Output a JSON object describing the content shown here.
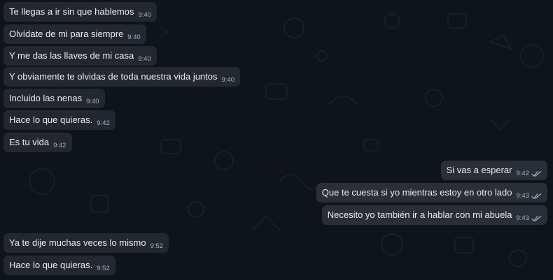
{
  "chat": {
    "incoming_1": [
      {
        "text": "Te llegas a ir sin que hablemos",
        "time": "9:40"
      },
      {
        "text": "Olvídate de mi para siempre",
        "time": "9:40"
      },
      {
        "text": "Y me das las llaves de mi casa",
        "time": "9:40"
      },
      {
        "text": "Y obviamente te olvidas de toda nuestra vida juntos",
        "time": "9:40"
      },
      {
        "text": "Incluido las nenas",
        "time": "9:40"
      },
      {
        "text": "Hace lo que quieras.",
        "time": "9:42"
      },
      {
        "text": "Es tu vida",
        "time": "9:42"
      }
    ],
    "outgoing": [
      {
        "text": "Si vas a esperar",
        "time": "9:42",
        "status": "read"
      },
      {
        "text": "Que te cuesta si yo mientras estoy en otro lado",
        "time": "9:43",
        "status": "read"
      },
      {
        "text": "Necesito yo también ir a hablar con mi abuela",
        "time": "9:43",
        "status": "read"
      }
    ],
    "incoming_2": [
      {
        "text": "Ya te dije muchas veces lo mismo",
        "time": "9:52"
      },
      {
        "text": "Hace lo que quieras.",
        "time": "9:52"
      }
    ]
  },
  "colors": {
    "background": "#0f141b",
    "incoming_bubble": "#232730",
    "outgoing_bubble": "#2a2e36",
    "text": "#e9edef",
    "meta": "#a7b0b8",
    "read_ticks": "#9fb3c8"
  },
  "icons": {
    "read_receipt": "double-check-icon"
  }
}
